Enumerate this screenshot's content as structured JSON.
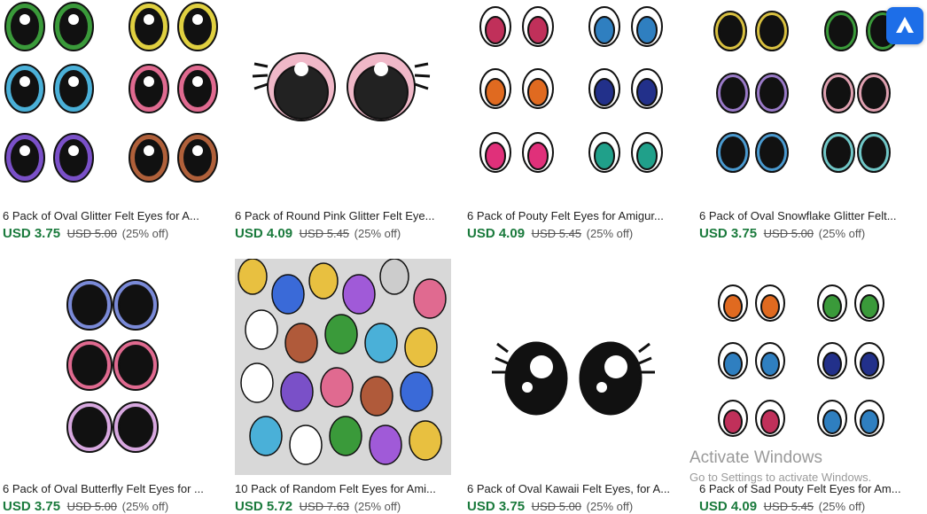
{
  "products": [
    {
      "title": "6 Pack of Oval Glitter Felt Eyes for A...",
      "price": "USD 3.75",
      "original": "USD 5.00",
      "discount": "(25% off)"
    },
    {
      "title": "6 Pack of Round Pink Glitter Felt Eye...",
      "price": "USD 4.09",
      "original": "USD 5.45",
      "discount": "(25% off)"
    },
    {
      "title": "6 Pack of Pouty Felt Eyes for Amigur...",
      "price": "USD 4.09",
      "original": "USD 5.45",
      "discount": "(25% off)"
    },
    {
      "title": "6 Pack of Oval Snowflake Glitter Felt...",
      "price": "USD 3.75",
      "original": "USD 5.00",
      "discount": "(25% off)"
    },
    {
      "title": "6 Pack of Oval Butterfly Felt Eyes for ...",
      "price": "USD 3.75",
      "original": "USD 5.00",
      "discount": "(25% off)"
    },
    {
      "title": "10 Pack of Random Felt Eyes for Ami...",
      "price": "USD 5.72",
      "original": "USD 7.63",
      "discount": "(25% off)"
    },
    {
      "title": "6 Pack of Oval Kawaii Felt Eyes, for A...",
      "price": "USD 3.75",
      "original": "USD 5.00",
      "discount": "(25% off)"
    },
    {
      "title": "6 Pack of Sad Pouty Felt Eyes for Am...",
      "price": "USD 4.09",
      "original": "USD 5.45",
      "discount": "(25% off)"
    }
  ],
  "watermark": {
    "line1": "Activate Windows",
    "line2": "Go to Settings to activate Windows."
  },
  "colors": {
    "price": "#1a7a3c",
    "badge": "#1d6ee8"
  },
  "icons": {
    "badge": "triangle-a-logo-icon"
  }
}
